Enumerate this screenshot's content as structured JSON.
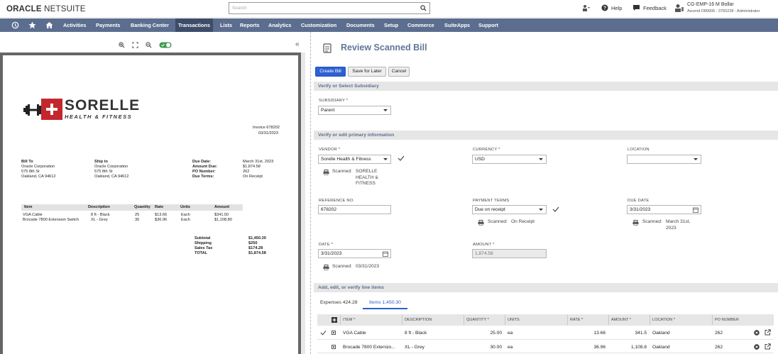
{
  "header": {
    "logo_brand": "ORACLE",
    "logo_product": "NETSUITE",
    "search_placeholder": "Search",
    "help_label": "Help",
    "feedback_label": "Feedback",
    "user_name": "CG-EMP-16 M Bollar",
    "user_role": "Ascend D89006 - 3760228 - Administrator"
  },
  "nav": [
    "Activities",
    "Payments",
    "Banking Center",
    "Transactions",
    "Lists",
    "Reports",
    "Analytics",
    "Customization",
    "Documents",
    "Setup",
    "Commerce",
    "SuiteApps",
    "Support"
  ],
  "nav_active": "Transactions",
  "invoice": {
    "company": "SORELLE",
    "tagline": "HEALTH & FITNESS",
    "invoice_no": "Invoice 678202",
    "invoice_date": "03/31/2023",
    "bill_to_title": "Bill To",
    "bill_to_lines": [
      "Oracle Corporation",
      "575 8th St",
      "Oakland, CA 94612"
    ],
    "ship_to_title": "Ship to",
    "ship_to_lines": [
      "Oracle Corporation",
      "575 8th St",
      "Oakland, CA 94612"
    ],
    "meta_labels": [
      "Due Date:",
      "Amount Due:",
      "PO Number:",
      "Due Terms:"
    ],
    "meta_values": [
      "March 31st, 2023",
      "$1,874.58",
      "262",
      "On Receipt"
    ],
    "table_headers": [
      "Item",
      "Description",
      "Quantity",
      "Rate",
      "Units",
      "Amount"
    ],
    "rows": [
      [
        "VGA Cable",
        "8 ft - Black",
        "25",
        "$13.66",
        "Each",
        "$341.50"
      ],
      [
        "Brocade 7800 Extension Switch",
        "XL - Grey",
        "30",
        "$36.96",
        "Each",
        "$1,108.80"
      ]
    ],
    "total_labels": [
      "Subtotal",
      "Shipping",
      "Sales Tax",
      "TOTAL"
    ],
    "total_values": [
      "$1,450.30",
      "$250",
      "$174.28",
      "$1,874.58"
    ]
  },
  "form": {
    "title": "Review Scanned Bill",
    "buttons": {
      "create": "Create Bill",
      "save_later": "Save for Later",
      "cancel": "Cancel"
    },
    "section_subsidiary": "Verify or Select Subsidiary",
    "subsidiary_label": "SUBSIDIARY *",
    "subsidiary_value": "Parent",
    "section_primary": "Verify or edit primary information",
    "vendor_label": "VENDOR *",
    "vendor_value": "Sorelle Health & Fitness",
    "vendor_scanned_label": "Scanned:",
    "vendor_scanned_value": "SORELLE\nHEALTH &\nFITNESS",
    "currency_label": "CURRENCY *",
    "currency_value": "USD",
    "location_label": "LOCATION",
    "location_value": "",
    "reference_label": "REFERENCE NO.",
    "reference_value": "678202",
    "terms_label": "PAYMENT TERMS",
    "terms_value": "Due on receipt",
    "terms_scanned_label": "Scanned:",
    "terms_scanned_value": "On Receipt",
    "duedate_label": "DUE DATE",
    "duedate_value": "3/31/2023",
    "duedate_scanned_label": "Scanned:",
    "duedate_scanned_value": "March 31st,\n2023",
    "date_label": "DATE *",
    "date_value": "3/31/2023",
    "date_scanned_label": "Scanned:",
    "date_scanned_value": "03/31/2023",
    "amount_label": "AMOUNT *",
    "amount_value": "1,874.58",
    "section_lines": "Add, edit, or verify line items"
  },
  "tabs": {
    "expenses": "Expenses 424.28",
    "items": "Items 1,450.30"
  },
  "items_table": {
    "headers": [
      "ITEM *",
      "DESCRIPTION",
      "QUANTITY *",
      "UNITS",
      "RATE *",
      "AMOUNT *",
      "LOCATION *",
      "PO NUMBER"
    ],
    "rows": [
      {
        "item": "VGA Cable",
        "description": "8 ft - Black",
        "quantity": "25.00",
        "units": "ea",
        "rate": "13.66",
        "amount": "341.5",
        "location": "Oakland",
        "po": "262"
      },
      {
        "item": "Brocade 7800 Extensio...",
        "description": "XL - Grey",
        "quantity": "30.00",
        "units": "ea",
        "rate": "36.96",
        "amount": "1,108.8",
        "location": "Oakland",
        "po": "262"
      }
    ]
  },
  "colors": {
    "nav_bg": "#5c6e8f",
    "nav_active": "#3d4c68",
    "primary_button": "#2e60d1",
    "title": "#607799",
    "logo_red": "#c4262e"
  }
}
